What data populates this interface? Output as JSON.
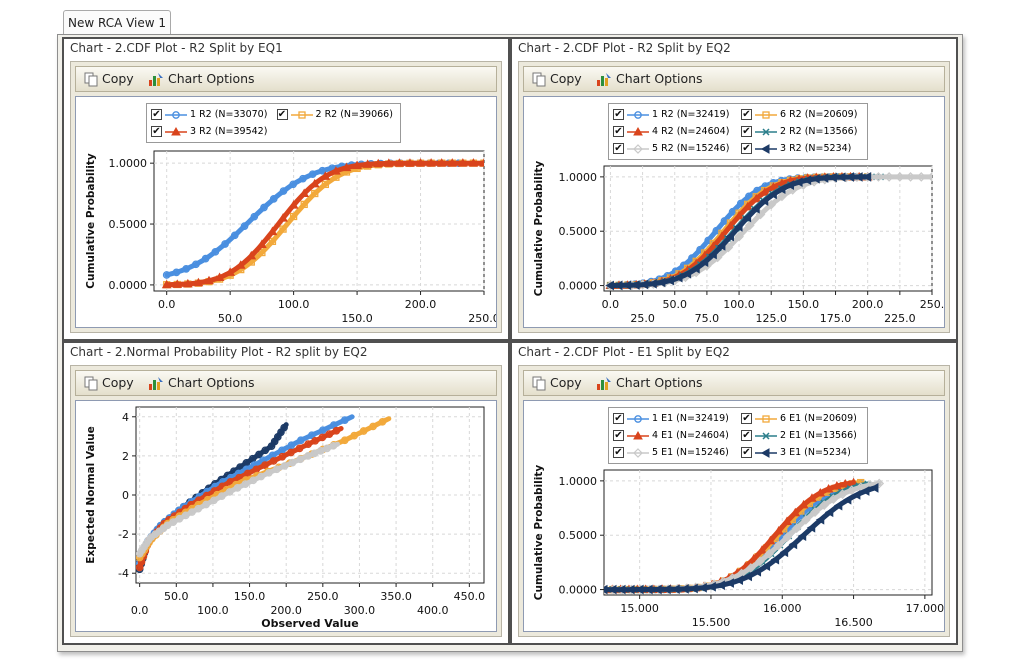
{
  "tab": {
    "label": "New RCA View 1"
  },
  "toolbar": {
    "copy_label": "Copy",
    "options_label": "Chart Options"
  },
  "colors": {
    "blue": "#4a8fe0",
    "orange": "#f2a93b",
    "red": "#d9441c",
    "gray": "#c9c9c9",
    "teal": "#2c7f8c",
    "navy": "#1c3a66"
  },
  "panels": [
    {
      "title": "Chart - 2.CDF Plot - R2 Split by EQ1",
      "chart_data": {
        "type": "scatter",
        "title": "",
        "xlabel": "",
        "ylabel": "Cumulative Probability",
        "xlim": [
          -10,
          250
        ],
        "ylim": [
          -0.05,
          1.1
        ],
        "x_ticks_top": [
          "0.0",
          "100.0",
          "200.0"
        ],
        "x_ticks_bottom": [
          "50.0",
          "150.0",
          "250.0"
        ],
        "y_ticks": [
          "0.0000",
          "0.5000",
          "1.0000"
        ],
        "legend_position": "top",
        "series": [
          {
            "name": "1 R2 (N=33070)",
            "color": "blue",
            "marker": "circle",
            "x0": 0,
            "mu": 65,
            "sigma": 38,
            "xmax": 230,
            "floor": 0.04
          },
          {
            "name": "2 R2 (N=39066)",
            "color": "orange",
            "marker": "square",
            "x0": 0,
            "mu": 95,
            "sigma": 32,
            "xmax": 250,
            "floor": 0.0
          },
          {
            "name": "3 R2 (N=39542)",
            "color": "red",
            "marker": "triangle",
            "x0": 0,
            "mu": 88,
            "sigma": 30,
            "xmax": 250,
            "floor": 0.0
          }
        ]
      }
    },
    {
      "title": "Chart - 2.CDF Plot - R2 Split by EQ2",
      "chart_data": {
        "type": "scatter",
        "title": "",
        "xlabel": "",
        "ylabel": "Cumulative Probability",
        "xlim": [
          -5,
          250
        ],
        "ylim": [
          -0.05,
          1.1
        ],
        "x_ticks_top": [
          "0.0",
          "50.0",
          "100.0",
          "150.0",
          "200.0",
          "250."
        ],
        "x_ticks_bottom": [
          "25.0",
          "75.0",
          "125.0",
          "175.0",
          "225.0"
        ],
        "y_ticks": [
          "0.0000",
          "0.5000",
          "1.0000"
        ],
        "legend_position": "top",
        "series": [
          {
            "name": "1 R2 (N=32419)",
            "color": "blue",
            "marker": "circle",
            "x0": 0,
            "mu": 82,
            "sigma": 28,
            "xmax": 190,
            "floor": 0.0
          },
          {
            "name": "6 R2 (N=20609)",
            "color": "orange",
            "marker": "square",
            "x0": 0,
            "mu": 88,
            "sigma": 28,
            "xmax": 200,
            "floor": 0.0
          },
          {
            "name": "4 R2 (N=24604)",
            "color": "red",
            "marker": "triangle",
            "x0": 0,
            "mu": 90,
            "sigma": 28,
            "xmax": 200,
            "floor": 0.0
          },
          {
            "name": "2 R2 (N=13566)",
            "color": "teal",
            "marker": "x",
            "x0": 0,
            "mu": 96,
            "sigma": 30,
            "xmax": 210,
            "floor": 0.0
          },
          {
            "name": "5 R2 (N=15246)",
            "color": "gray",
            "marker": "diamond",
            "x0": 0,
            "mu": 104,
            "sigma": 32,
            "xmax": 250,
            "floor": 0.0
          },
          {
            "name": "3 R2 (N=5234)",
            "color": "navy",
            "marker": "ltri",
            "x0": 0,
            "mu": 97,
            "sigma": 30,
            "xmax": 200,
            "floor": 0.0
          }
        ]
      }
    },
    {
      "title": "Chart - 2.Normal Probability Plot - R2 split by EQ2",
      "chart_data": {
        "type": "scatter",
        "title": "",
        "xlabel": "Observed Value",
        "ylabel": "Expected Normal Value",
        "xlim": [
          -5,
          470
        ],
        "ylim": [
          -4.5,
          4.5
        ],
        "x_ticks_top": [
          "50.0",
          "150.0",
          "250.0",
          "350.0",
          "450.0"
        ],
        "x_ticks_bottom": [
          "0.0",
          "100.0",
          "200.0",
          "300.0",
          "400.0"
        ],
        "y_ticks": [
          "-4",
          "-2",
          "0",
          "2",
          "4"
        ],
        "series": [
          {
            "name": "",
            "color": "navy",
            "marker": "circle",
            "xs": [
              0,
              10,
              30,
              60,
              100,
              140,
              180,
              200
            ],
            "ys": [
              -3.8,
              -2.5,
              -1.5,
              -0.6,
              0.5,
              1.5,
              2.5,
              3.6
            ]
          },
          {
            "name": "",
            "color": "blue",
            "marker": "circle",
            "xs": [
              0,
              10,
              30,
              60,
              110,
              160,
              220,
              290
            ],
            "ys": [
              -3.5,
              -2.4,
              -1.5,
              -0.6,
              0.6,
              1.6,
              2.8,
              4.0
            ]
          },
          {
            "name": "",
            "color": "red",
            "marker": "circle",
            "xs": [
              0,
              12,
              35,
              70,
              120,
              175,
              230,
              275
            ],
            "ys": [
              -3.7,
              -2.4,
              -1.4,
              -0.5,
              0.6,
              1.6,
              2.6,
              3.4
            ]
          },
          {
            "name": "",
            "color": "orange",
            "marker": "circle",
            "xs": [
              0,
              15,
              40,
              80,
              140,
              210,
              280,
              340
            ],
            "ys": [
              -3.2,
              -2.3,
              -1.4,
              -0.5,
              0.7,
              1.7,
              2.8,
              3.9
            ]
          },
          {
            "name": "",
            "color": "gray",
            "marker": "circle",
            "xs": [
              0,
              14,
              40,
              80,
              130,
              180,
              230,
              270
            ],
            "ys": [
              -3.0,
              -2.2,
              -1.5,
              -0.7,
              0.3,
              1.2,
              2.0,
              2.6
            ]
          }
        ]
      }
    },
    {
      "title": "Chart - 2.CDF Plot - E1 Split by EQ2",
      "chart_data": {
        "type": "scatter",
        "title": "",
        "xlabel": "",
        "ylabel": "Cumulative Probability",
        "xlim": [
          14.75,
          17.05
        ],
        "ylim": [
          -0.05,
          1.1
        ],
        "x_ticks_top": [
          "15.000",
          "16.000",
          "17.000"
        ],
        "x_ticks_bottom": [
          "15.500",
          "16.500"
        ],
        "y_ticks": [
          "0.0000",
          "0.5000",
          "1.0000"
        ],
        "legend_position": "top",
        "series": [
          {
            "name": "1 E1 (N=32419)",
            "color": "blue",
            "marker": "circle",
            "x0": 14.75,
            "mu": 16.0,
            "sigma": 0.28,
            "xmax": 16.55,
            "floor": 0.0
          },
          {
            "name": "6 E1 (N=20609)",
            "color": "orange",
            "marker": "square",
            "x0": 14.75,
            "mu": 15.97,
            "sigma": 0.27,
            "xmax": 16.55,
            "floor": 0.0
          },
          {
            "name": "4 E1 (N=24604)",
            "color": "red",
            "marker": "triangle",
            "x0": 14.75,
            "mu": 15.95,
            "sigma": 0.26,
            "xmax": 16.5,
            "floor": 0.0
          },
          {
            "name": "2 E1 (N=13566)",
            "color": "teal",
            "marker": "x",
            "x0": 14.75,
            "mu": 16.05,
            "sigma": 0.29,
            "xmax": 16.6,
            "floor": 0.0
          },
          {
            "name": "5 E1 (N=15246)",
            "color": "gray",
            "marker": "diamond",
            "x0": 14.75,
            "mu": 16.05,
            "sigma": 0.32,
            "xmax": 16.68,
            "floor": 0.0
          },
          {
            "name": "3 E1 (N=5234)",
            "color": "navy",
            "marker": "ltri",
            "x0": 14.75,
            "mu": 16.15,
            "sigma": 0.33,
            "xmax": 16.65,
            "floor": 0.0
          }
        ]
      }
    }
  ]
}
